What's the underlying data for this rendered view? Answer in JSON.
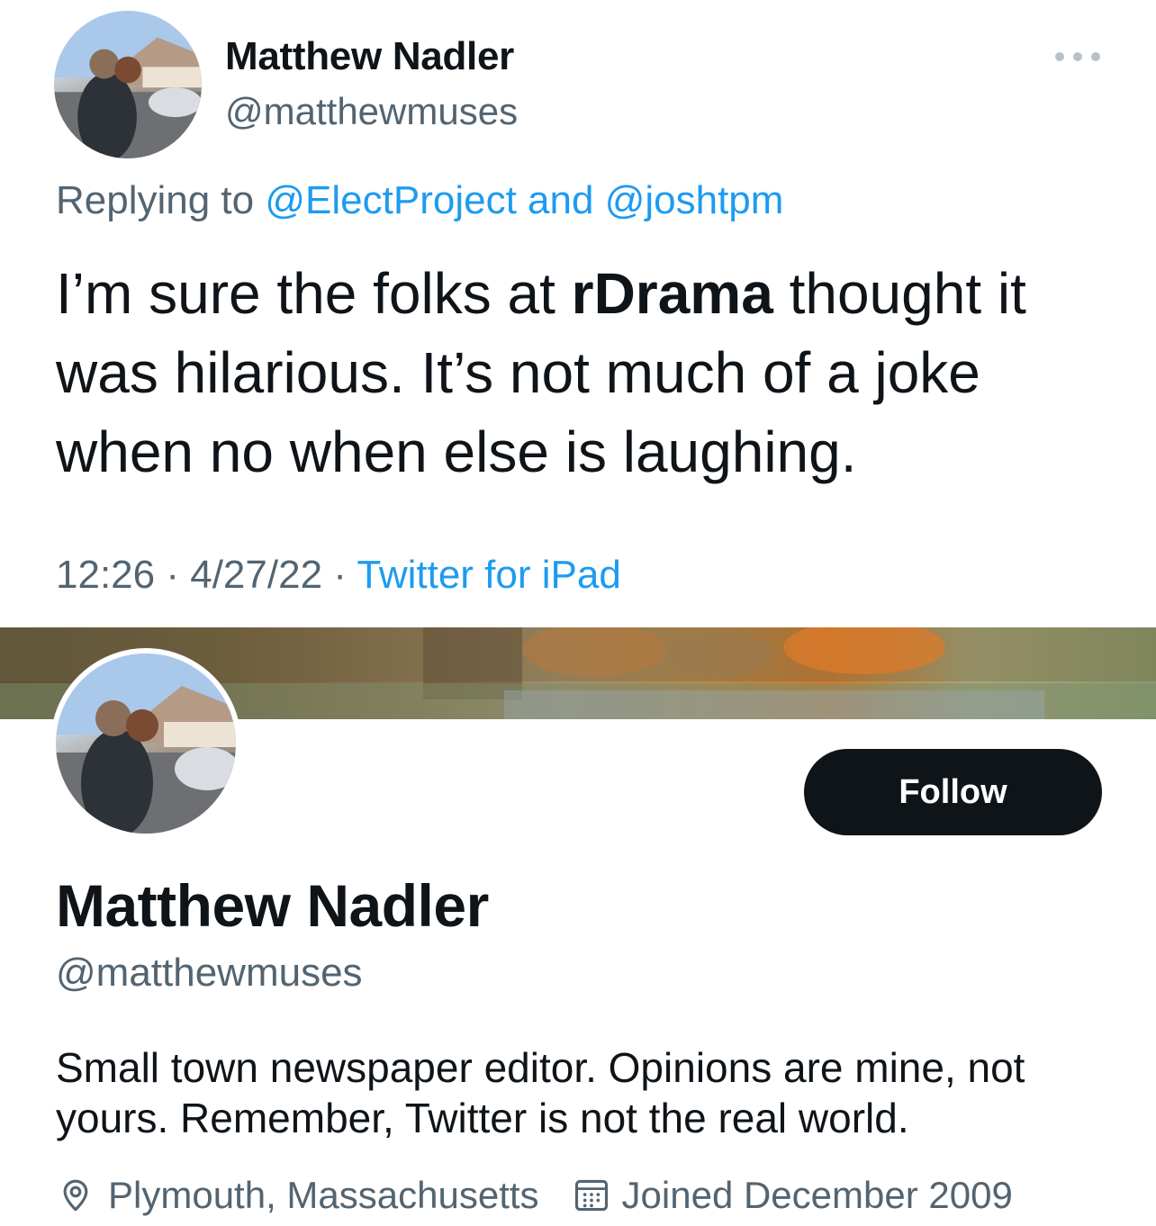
{
  "tweet": {
    "author_name": "Matthew Nadler",
    "author_handle": "@matthewmuses",
    "replying_to_prefix": "Replying to",
    "replying_to_user1": "@ElectProject",
    "replying_to_and": "and",
    "replying_to_user2": "@joshtpm",
    "text_part1": "I’m sure the folks at ",
    "text_bold": "rDrama",
    "text_part2": " thought it was hilarious. It’s not much of a joke when no when else is laughing.",
    "time": "12:26",
    "separator": "·",
    "date": "4/27/22",
    "source": "Twitter for iPad"
  },
  "profile": {
    "name": "Matthew Nadler",
    "handle": "@matthewmuses",
    "follow_label": "Follow",
    "bio": "Small town newspaper editor. Opinions are mine, not yours. Remember, Twitter is not the real world.",
    "location": "Plymouth, Massachusetts",
    "joined": "Joined December 2009"
  },
  "icons": {
    "more": "more-horizontal-icon",
    "location": "location-pin-icon",
    "calendar": "calendar-icon"
  },
  "colors": {
    "link": "#1d9bf0",
    "secondary_text": "#536471",
    "primary_text": "#0f1419",
    "follow_button_bg": "#0f1419"
  }
}
